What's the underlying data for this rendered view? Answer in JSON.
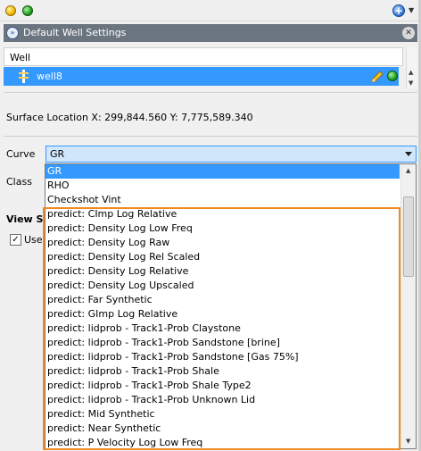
{
  "panel": {
    "title": "Default Well Settings"
  },
  "well_table": {
    "header": "Well",
    "rows": [
      {
        "name": "well8"
      }
    ]
  },
  "surface_location": "Surface Location X: 299,844.560  Y: 7,775,589.340",
  "form": {
    "curve_label": "Curve",
    "class_label": "Class",
    "view_settings_label": "View Se",
    "use_label": "Use",
    "use_checked": true
  },
  "curve_combo": {
    "value": "GR",
    "options": [
      "GR",
      "RHO",
      "Checkshot Vint",
      "predict: CImp Log  Relative",
      "predict: Density Log  Low Freq",
      "predict: Density Log  Raw",
      "predict: Density Log  Rel Scaled",
      "predict: Density Log  Relative",
      "predict: Density Log  Upscaled",
      "predict: Far Synthetic",
      "predict: GImp Log  Relative",
      "predict: lidprob - Track1-Prob Claystone",
      "predict: lidprob - Track1-Prob Sandstone [brine]",
      "predict: lidprob - Track1-Prob Sandstone [Gas 75%]",
      "predict: lidprob - Track1-Prob Shale",
      "predict: lidprob - Track1-Prob Shale Type2",
      "predict: lidprob - Track1-Prob Unknown Lid",
      "predict: Mid Synthetic",
      "predict: Near Synthetic",
      "predict: P Velocity Log  Low Freq"
    ],
    "selected_index": 0
  },
  "icons": {
    "yellow_status": "yellow-dot-icon",
    "green_status": "green-dot-icon",
    "add": "add-icon",
    "expand": "expand-icon",
    "close": "close-icon",
    "well": "well-icon",
    "edit": "pencil-icon"
  },
  "colors": {
    "selection": "#3399ff",
    "highlight_border": "#f08a24",
    "panel_header": "#6b7580"
  }
}
